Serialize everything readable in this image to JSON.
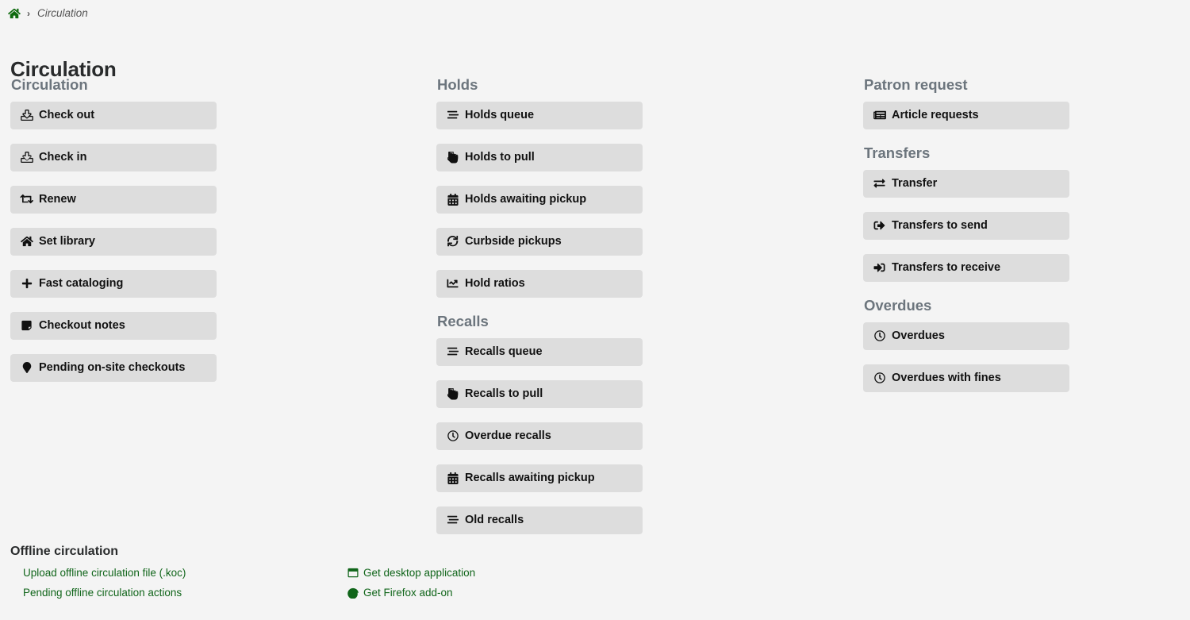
{
  "breadcrumb": {
    "home_icon": "home-icon",
    "separator": "›",
    "current": "Circulation"
  },
  "page_title": "Circulation",
  "colors": {
    "page_background": "#f4f4f4",
    "button_background": "#dddddd",
    "section_heading": "#6c757d",
    "link_green": "#10651a",
    "title_color": "#292b2c"
  },
  "columns": [
    {
      "sections": [
        {
          "heading": "Circulation",
          "items": [
            {
              "label": "Check out",
              "icon": "upload-icon"
            },
            {
              "label": "Check in",
              "icon": "download-icon"
            },
            {
              "label": "Renew",
              "icon": "retweet-icon"
            },
            {
              "label": "Set library",
              "icon": "home-icon"
            },
            {
              "label": "Fast cataloging",
              "icon": "plus-icon"
            },
            {
              "label": "Checkout notes",
              "icon": "sticky-note-icon"
            },
            {
              "label": "Pending on-site checkouts",
              "icon": "map-marker-icon"
            }
          ]
        }
      ]
    },
    {
      "sections": [
        {
          "heading": "Holds",
          "items": [
            {
              "label": "Holds queue",
              "icon": "stream-list-icon"
            },
            {
              "label": "Holds to pull",
              "icon": "hand-pointer-icon"
            },
            {
              "label": "Holds awaiting pickup",
              "icon": "calendar-icon"
            },
            {
              "label": "Curbside pickups",
              "icon": "sync-icon"
            },
            {
              "label": "Hold ratios",
              "icon": "chart-line-icon"
            }
          ]
        },
        {
          "heading": "Recalls",
          "items": [
            {
              "label": "Recalls queue",
              "icon": "stream-list-icon"
            },
            {
              "label": "Recalls to pull",
              "icon": "hand-pointer-icon"
            },
            {
              "label": "Overdue recalls",
              "icon": "clock-icon"
            },
            {
              "label": "Recalls awaiting pickup",
              "icon": "calendar-icon"
            },
            {
              "label": "Old recalls",
              "icon": "stream-list-icon"
            }
          ]
        }
      ]
    },
    {
      "sections": [
        {
          "heading": "Patron request",
          "items": [
            {
              "label": "Article requests",
              "icon": "newspaper-icon"
            }
          ]
        },
        {
          "heading": "Transfers",
          "items": [
            {
              "label": "Transfer",
              "icon": "right-left-arrows-icon"
            },
            {
              "label": "Transfers to send",
              "icon": "sign-out-icon"
            },
            {
              "label": "Transfers to receive",
              "icon": "sign-in-icon"
            }
          ]
        },
        {
          "heading": "Overdues",
          "items": [
            {
              "label": "Overdues",
              "icon": "clock-icon"
            },
            {
              "label": "Overdues with fines",
              "icon": "clock-icon"
            }
          ]
        }
      ]
    }
  ],
  "offline": {
    "heading": "Offline circulation",
    "links": [
      {
        "label": "Upload offline circulation file (.koc)",
        "icon": null
      },
      {
        "label": "Pending offline circulation actions",
        "icon": null
      },
      {
        "label": "Get desktop application",
        "icon": "window-icon"
      },
      {
        "label": "Get Firefox add-on",
        "icon": "firefox-icon"
      }
    ]
  }
}
